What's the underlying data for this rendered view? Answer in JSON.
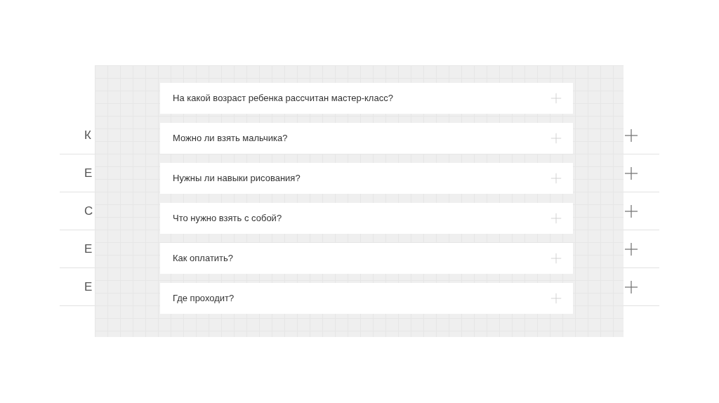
{
  "background_faq": [
    {
      "label": "К",
      "expanded": false
    },
    {
      "label": "Е",
      "expanded": false
    },
    {
      "label": "С",
      "expanded": false
    },
    {
      "label": "Е",
      "expanded": false
    },
    {
      "label": "Е",
      "expanded": false
    }
  ],
  "faq_panel": {
    "items": [
      {
        "question": "На какой возраст ребенка рассчитан мастер-класс?",
        "expanded": false
      },
      {
        "question": "Можно ли взять мальчика?",
        "expanded": false
      },
      {
        "question": "Нужны ли навыки рисования?",
        "expanded": false
      },
      {
        "question": "Что нужно взять с собой?",
        "expanded": false
      },
      {
        "question": "Как оплатить?",
        "expanded": false
      },
      {
        "question": "Где проходит?",
        "expanded": false
      }
    ]
  }
}
